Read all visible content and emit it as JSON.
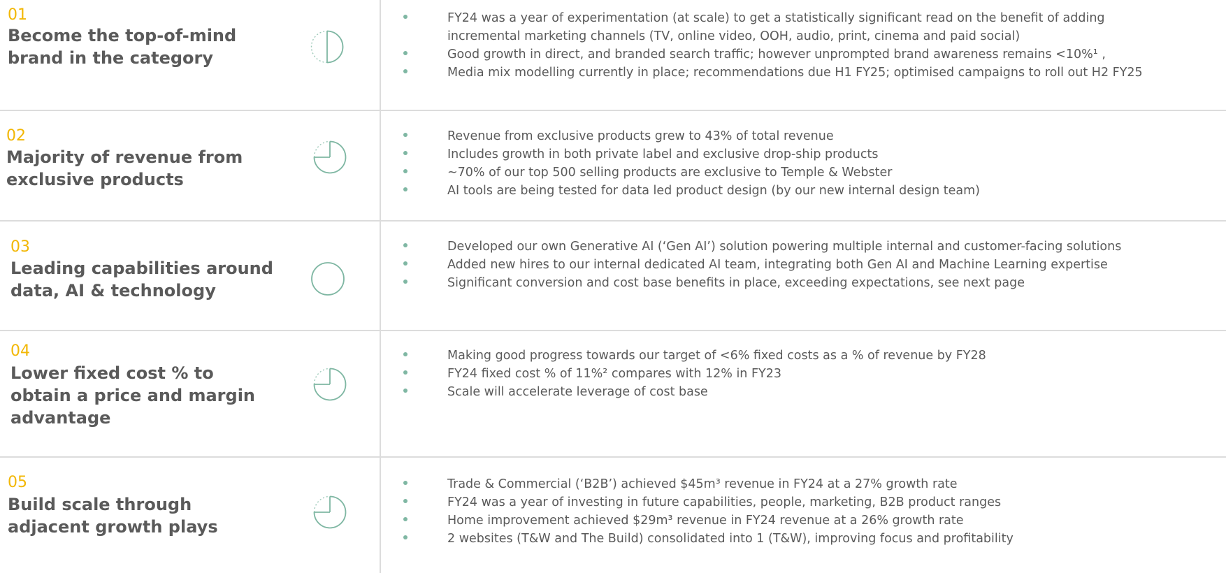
{
  "pillars": [
    {
      "number": "01",
      "title_lines": [
        "Become  the top-of-mind",
        "brand in the category"
      ],
      "progress_icon": "progress-half-icon",
      "progress_fraction": 0.5,
      "bullets": [
        "FY24 was a year of experimentation (at scale) to get a statistically significant read on the benefit of adding",
        "incremental marketing channels (TV, online video, OOH, audio, print, cinema and paid social)",
        "Good growth in direct, and branded search traffic; however unprompted brand awareness remains <10%¹ ,",
        "Media mix modelling currently in place; recommendations due H1 FY25; optimised campaigns to roll out H2 FY25"
      ],
      "bullet_has_dot": [
        true,
        false,
        true,
        true
      ]
    },
    {
      "number": "02",
      "title_lines": [
        "Majority of revenue from",
        "exclusive products"
      ],
      "progress_icon": "progress-quarter-icon",
      "progress_fraction": 0.75,
      "bullets": [
        "Revenue from exclusive products grew to 43% of total revenue",
        "Includes growth in both private label and exclusive drop-ship products",
        "~70% of our top 500 selling products are exclusive to Temple & Webster",
        "AI tools are being tested for data led product design (by our new internal design team)"
      ],
      "bullet_has_dot": [
        true,
        true,
        true,
        true
      ]
    },
    {
      "number": "03",
      "title_lines": [
        "Leading capabilities around",
        "data, AI & technology"
      ],
      "progress_icon": "progress-full-icon",
      "progress_fraction": 1,
      "bullets": [
        "Developed our own Generative AI (‘Gen AI’) solution powering multiple internal and customer-facing solutions",
        "Added new hires to our internal dedicated AI team, integrating both Gen AI and Machine Learning expertise",
        "Significant conversion and cost base benefits in place, exceeding expectations, see next page"
      ],
      "bullet_has_dot": [
        true,
        true,
        true
      ]
    },
    {
      "number": "04",
      "title_lines": [
        "Lower fixed cost % to",
        "obtain a price and margin",
        "advantage"
      ],
      "progress_icon": "progress-quarter-icon",
      "progress_fraction": 0.75,
      "bullets": [
        "Making good progress towards our target of <6% fixed costs as a % of revenue by FY28",
        "FY24 fixed cost % of 11%² compares with 12% in FY23",
        "Scale will accelerate leverage of cost base"
      ],
      "bullet_has_dot": [
        true,
        true,
        true
      ]
    },
    {
      "number": "05",
      "title_lines": [
        "Build scale through",
        "adjacent growth plays"
      ],
      "progress_icon": "progress-quarter-icon",
      "progress_fraction": 0.75,
      "bullets": [
        "Trade & Commercial (‘B2B’) achieved $45m³ revenue in FY24 at a 27% growth rate",
        "FY24 was a year of investing in future capabilities, people, marketing, B2B product ranges",
        "Home improvement achieved $29m³ revenue in FY24 revenue at a 26% growth rate",
        "2 websites (T&W and The Build) consolidated into 1 (T&W), improving focus and profitability"
      ],
      "bullet_has_dot": [
        true,
        true,
        true,
        true
      ]
    }
  ],
  "colors": {
    "number": "#f2b705",
    "title": "#5a5a5a",
    "text": "#5a5a5a",
    "accent": "#7fb7a3",
    "divider": "#dcdcdc"
  }
}
